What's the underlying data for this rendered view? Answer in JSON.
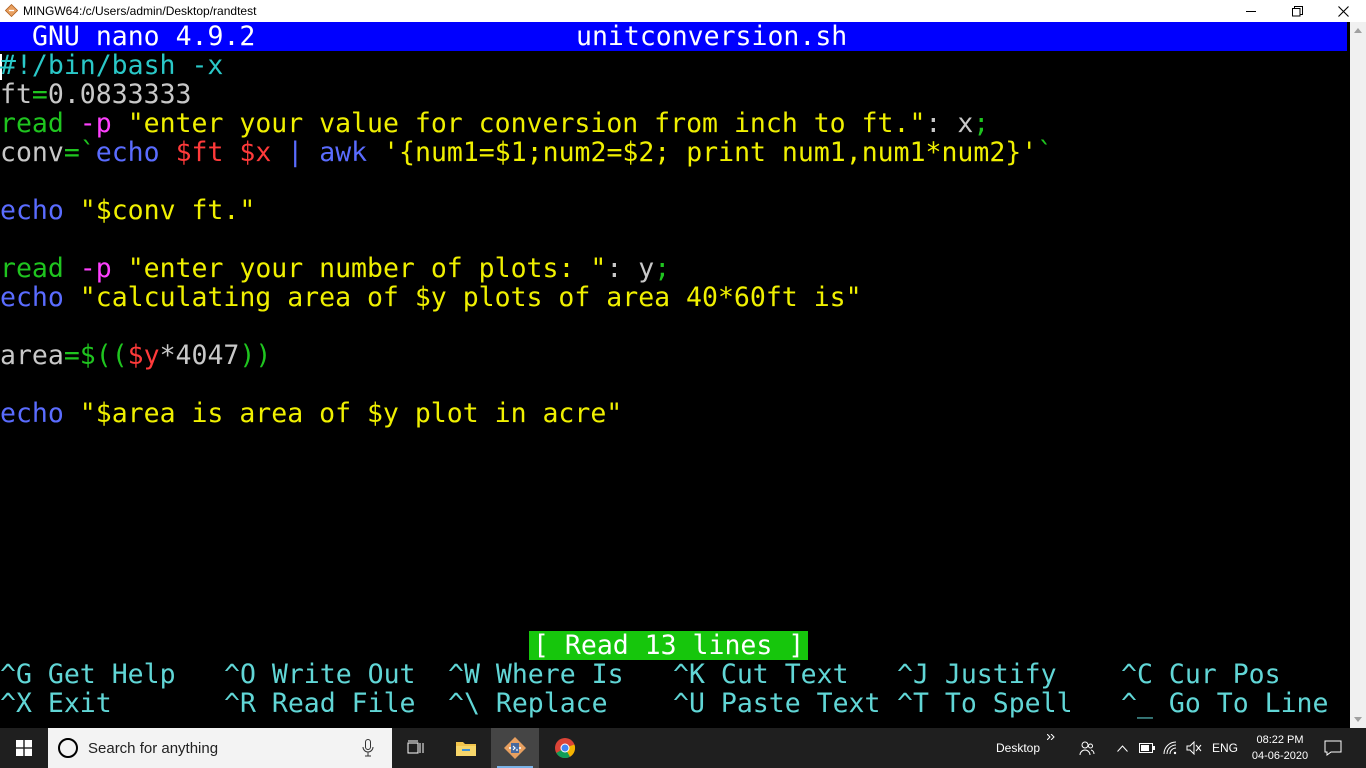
{
  "window": {
    "title": "MINGW64:/c/Users/admin/Desktop/randtest"
  },
  "nano": {
    "version": "GNU nano 4.9.2",
    "filename": "unitconversion.sh",
    "status": "[ Read 13 lines ]"
  },
  "code": {
    "l1": "#!/bin/bash -x",
    "l2_var": "ft",
    "l2_eq": "=",
    "l2_val": "0.0833333",
    "l3_cmd": "read",
    "l3_opt": "-p",
    "l3_str": "\"enter your value for conversion from inch to ft.\"",
    "l3_rest": ": x",
    "l3_semi": ";",
    "l4_var": "conv",
    "l4_eq": "=",
    "l4_bt": "`",
    "l4_echo": "echo",
    "l4_ft": "$ft",
    "l4_x": "$x",
    "l4_pipe": "|",
    "l4_awk": "awk",
    "l4_prog": "'{num1=$1;num2=$2; print num1,num1*num2}'",
    "l4_bt2": "`",
    "l6_echo": "echo",
    "l6_str": "\"$conv ft.\"",
    "l8_cmd": "read",
    "l8_opt": "-p",
    "l8_str": "\"enter your number of plots: \"",
    "l8_rest": ": y",
    "l8_semi": ";",
    "l9_echo": "echo",
    "l9_str": "\"calculating area of $y plots of area 40*60ft is\"",
    "l11_var": "area",
    "l11_eq": "=$((",
    "l11_y": "$y",
    "l11_mul": "*4047",
    "l11_end": "))",
    "l13_echo": "echo",
    "l13_str": "\"$area is area of $y plot in acre\""
  },
  "shortcuts": [
    {
      "key": "^G",
      "label": "Get Help"
    },
    {
      "key": "^O",
      "label": "Write Out"
    },
    {
      "key": "^W",
      "label": "Where Is"
    },
    {
      "key": "^K",
      "label": "Cut Text"
    },
    {
      "key": "^J",
      "label": "Justify"
    },
    {
      "key": "^C",
      "label": "Cur Pos"
    },
    {
      "key": "^X",
      "label": "Exit"
    },
    {
      "key": "^R",
      "label": "Read File"
    },
    {
      "key": "^\\",
      "label": "Replace"
    },
    {
      "key": "^U",
      "label": "Paste Text"
    },
    {
      "key": "^T",
      "label": "To Spell"
    },
    {
      "key": "^_",
      "label": "Go To Line"
    }
  ],
  "taskbar": {
    "search_placeholder": "Search for anything",
    "desktop_label": "Desktop",
    "language": "ENG",
    "time": "08:22 PM",
    "date": "04-06-2020"
  },
  "colors": {
    "nano_header_bg": "#0000ff",
    "status_bg": "#16c60c",
    "shortcut_text": "#61d6d6"
  }
}
